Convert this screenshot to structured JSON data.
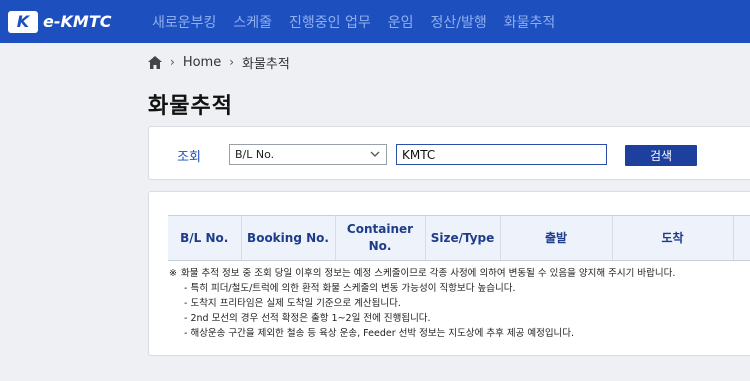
{
  "header": {
    "logo_mark": "K",
    "logo_text": "e-KMTC",
    "nav": [
      "새로운부킹",
      "스케줄",
      "진행중인 업무",
      "운임",
      "정산/발행",
      "화물추적"
    ]
  },
  "breadcrumb": {
    "home": "Home",
    "current": "화물추적",
    "separator": "›"
  },
  "page": {
    "title": "화물추적"
  },
  "search": {
    "label": "조회",
    "select_value": "B/L No.",
    "input_value": "KMTC",
    "button_label": "검색"
  },
  "table": {
    "headers": [
      "B/L No.",
      "Booking No.",
      "Container No.",
      "Size/Type",
      "출발",
      "도착"
    ]
  },
  "notes": {
    "mark": "※",
    "lead": "화물 추적 정보 중 조회 당일 이후의 정보는 예정 스케줄이므로 각종 사정에 의하여 변동될 수 있음을 양지해 주시기 바랍니다.",
    "items": [
      "- 특히 피더/철도/트럭에 의한 환적 화물 스케줄의 변동 가능성이 직항보다 높습니다.",
      "- 도착지 프리타임은 실제 도착일 기준으로 계산됩니다.",
      "- 2nd 모선의 경우 선적 확정은 출항 1~2일 전에 진행됩니다.",
      "- 해상운송 구간을 제외한 철송 등 육상 운송, Feeder 선박 정보는 지도상에 추후 제공 예정입니다."
    ]
  },
  "colors": {
    "brand_blue": "#1d4fbf",
    "nav_text": "#8fb0ef",
    "button": "#1d3f9e",
    "table_header_bg": "#edf2fb"
  }
}
